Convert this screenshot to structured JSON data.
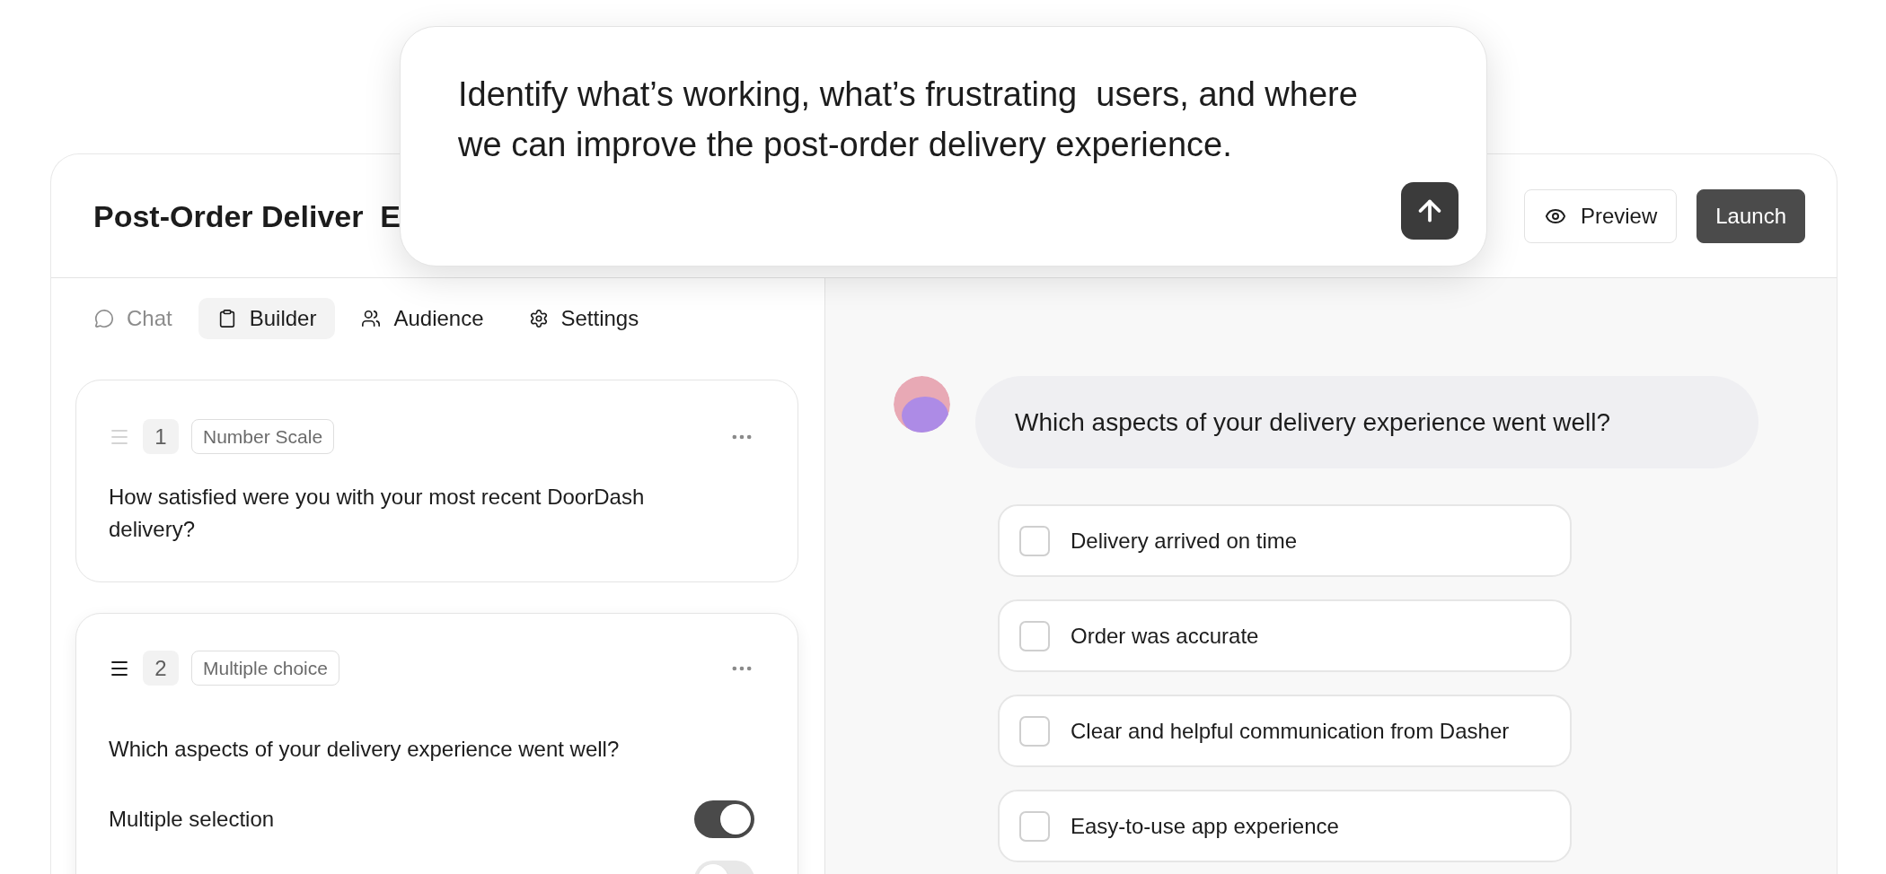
{
  "window": {
    "title": "Post-Order Deliver  E"
  },
  "header_buttons": [
    {
      "label": "Preview",
      "kind": "outline"
    },
    {
      "label": "Launch",
      "kind": "primary"
    }
  ],
  "prompt": {
    "value": "Identify what’s working, what’s frustrating  users, and where we can improve the post-order delivery experience."
  },
  "tabs": [
    {
      "label": "Chat",
      "selected": false,
      "disabled": true
    },
    {
      "label": "Builder",
      "selected": true,
      "disabled": false
    },
    {
      "label": "Audience",
      "selected": false,
      "disabled": false
    },
    {
      "label": "Settings",
      "selected": false,
      "disabled": false
    }
  ],
  "questions": [
    {
      "number": "1",
      "type": "Number Scale",
      "text": "How satisfied were you with your most recent DoorDash delivery?",
      "selected": false
    },
    {
      "number": "2",
      "type": "Multiple choice",
      "text": "Which aspects of your delivery experience went well?",
      "selected": true,
      "settings": [
        {
          "label": "Multiple selection",
          "on": true
        },
        {
          "on": false
        }
      ]
    }
  ],
  "preview": {
    "question": "Which aspects of your delivery experience went well?",
    "options": [
      {
        "label": "Delivery arrived on time",
        "checked": false
      },
      {
        "label": "Order was accurate",
        "checked": false
      },
      {
        "label": "Clear and helpful communication from Dasher",
        "checked": false
      },
      {
        "label": "Easy-to-use app experience",
        "checked": false
      }
    ]
  }
}
